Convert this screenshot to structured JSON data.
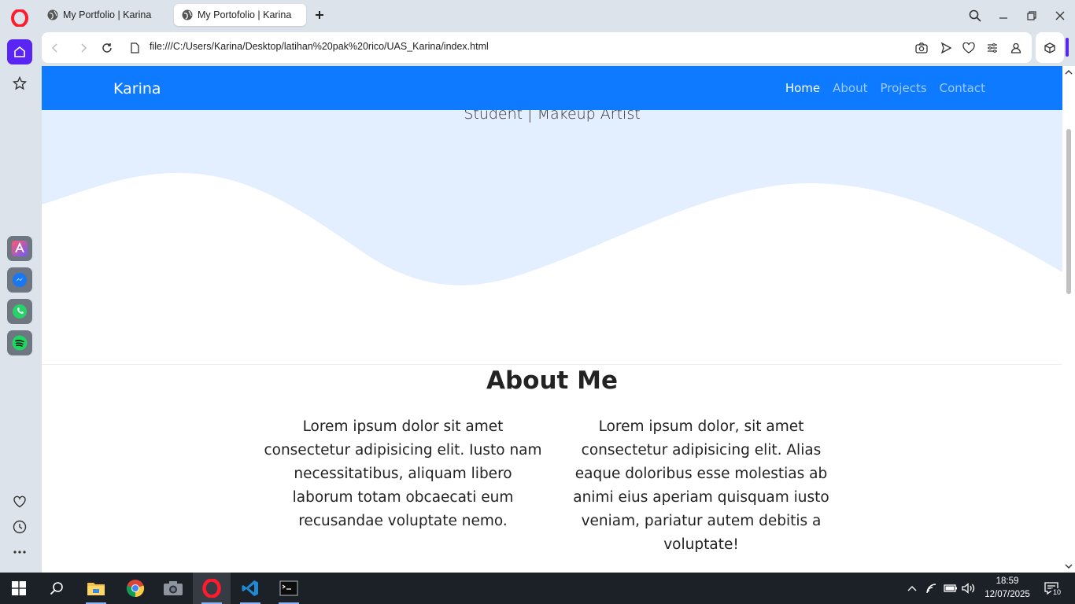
{
  "browser": {
    "tabs": [
      {
        "title": "My Portfolio | Karina",
        "active": false
      },
      {
        "title": "My Portofolio | Karina",
        "active": true
      }
    ],
    "url": "file:///C:/Users/Karina/Desktop/latihan%20pak%20rico/UAS_Karina/index.html"
  },
  "page": {
    "brand": "Karina",
    "nav": [
      {
        "label": "Home",
        "active": true
      },
      {
        "label": "About",
        "active": false
      },
      {
        "label": "Projects",
        "active": false
      },
      {
        "label": "Contact",
        "active": false
      }
    ],
    "hero_subtitle": "Student | Makeup Artist",
    "about": {
      "title": "About Me",
      "col1": "Lorem ipsum dolor sit amet consectetur adipisicing elit. Iusto nam necessitatibus, aliquam libero laborum totam obcaecati eum recusandae voluptate nemo.",
      "col2": "Lorem ipsum dolor, sit amet consectetur adipisicing elit. Alias eaque doloribus esse molestias ab animi eius aperiam quisquam iusto veniam, pariatur autem debitis a voluptate!"
    },
    "colors": {
      "navbar": "#0d7aff",
      "wave": "#e3eeff"
    }
  },
  "sidebar": {
    "items": [
      "home-icon",
      "star-icon",
      "aria-icon",
      "messenger-icon",
      "whatsapp-icon",
      "spotify-icon",
      "heart-icon",
      "history-icon",
      "more-icon"
    ]
  },
  "taskbar": {
    "apps": [
      "start-icon",
      "search-icon",
      "file-explorer-icon",
      "chrome-icon",
      "camera-icon",
      "opera-icon",
      "vscode-icon",
      "terminal-icon"
    ],
    "time": "18:59",
    "date": "12/07/2025",
    "notifications": "10"
  }
}
